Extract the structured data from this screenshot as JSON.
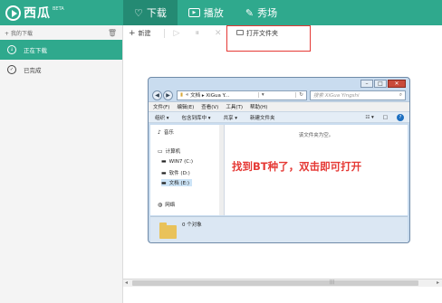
{
  "app": {
    "logo_text": "西瓜",
    "logo_badge": "BETA"
  },
  "nav": {
    "tabs": [
      {
        "label": "下载",
        "icon": "heart-icon",
        "glyph": "♡"
      },
      {
        "label": "播放",
        "icon": "tv-icon",
        "glyph": "▶"
      },
      {
        "label": "秀场",
        "icon": "brush-icon",
        "glyph": "✎"
      }
    ]
  },
  "sidebar": {
    "header": "我的下载",
    "header_icon": "+",
    "trash_icon": "trash-icon",
    "items": [
      {
        "label": "正在下载",
        "glyph": "↓"
      },
      {
        "label": "已完成",
        "glyph": "✓"
      }
    ]
  },
  "toolbar": {
    "new_label": "新建",
    "new_glyph": "+",
    "play_glyph": "▷",
    "pause_glyph": "⏸",
    "delete_glyph": "✕",
    "open_folder_label": "打开文件夹"
  },
  "explorer": {
    "address_prefix": "«",
    "address_path": "文档 ▸ XiGua Y...",
    "address_drop": "▾",
    "refresh_glyph": "↻",
    "search_placeholder": "搜索 XiGua Yingshi",
    "search_glyph": "⌕",
    "menu": [
      "文件(F)",
      "编辑(E)",
      "查看(V)",
      "工具(T)",
      "帮助(H)"
    ],
    "commands": [
      "组织 ▾",
      "包含到库中 ▾",
      "共享 ▾",
      "新建文件夹"
    ],
    "view_glyphs": [
      "☷ ▾",
      "□"
    ],
    "help_glyph": "?",
    "window_controls": [
      "–",
      "□",
      "✕"
    ],
    "nav_pane": [
      {
        "label": "音乐",
        "glyph": "♪"
      },
      {
        "label": "计算机",
        "glyph": "▭"
      },
      {
        "label": "WIN7 (C:)",
        "glyph": "▬"
      },
      {
        "label": "软件 (D:)",
        "glyph": "▬"
      },
      {
        "label": "文档 (E:)",
        "glyph": "▬",
        "selected": true
      },
      {
        "label": "网络",
        "glyph": "◍"
      }
    ],
    "empty_message": "该文件夹为空。",
    "status_count": "0 个对象"
  },
  "annotation": "找到BT种了，双击即可打开",
  "colors": {
    "brand_green": "#2fa98d",
    "brand_green_dark": "#248a73",
    "highlight_red": "#e53935"
  }
}
